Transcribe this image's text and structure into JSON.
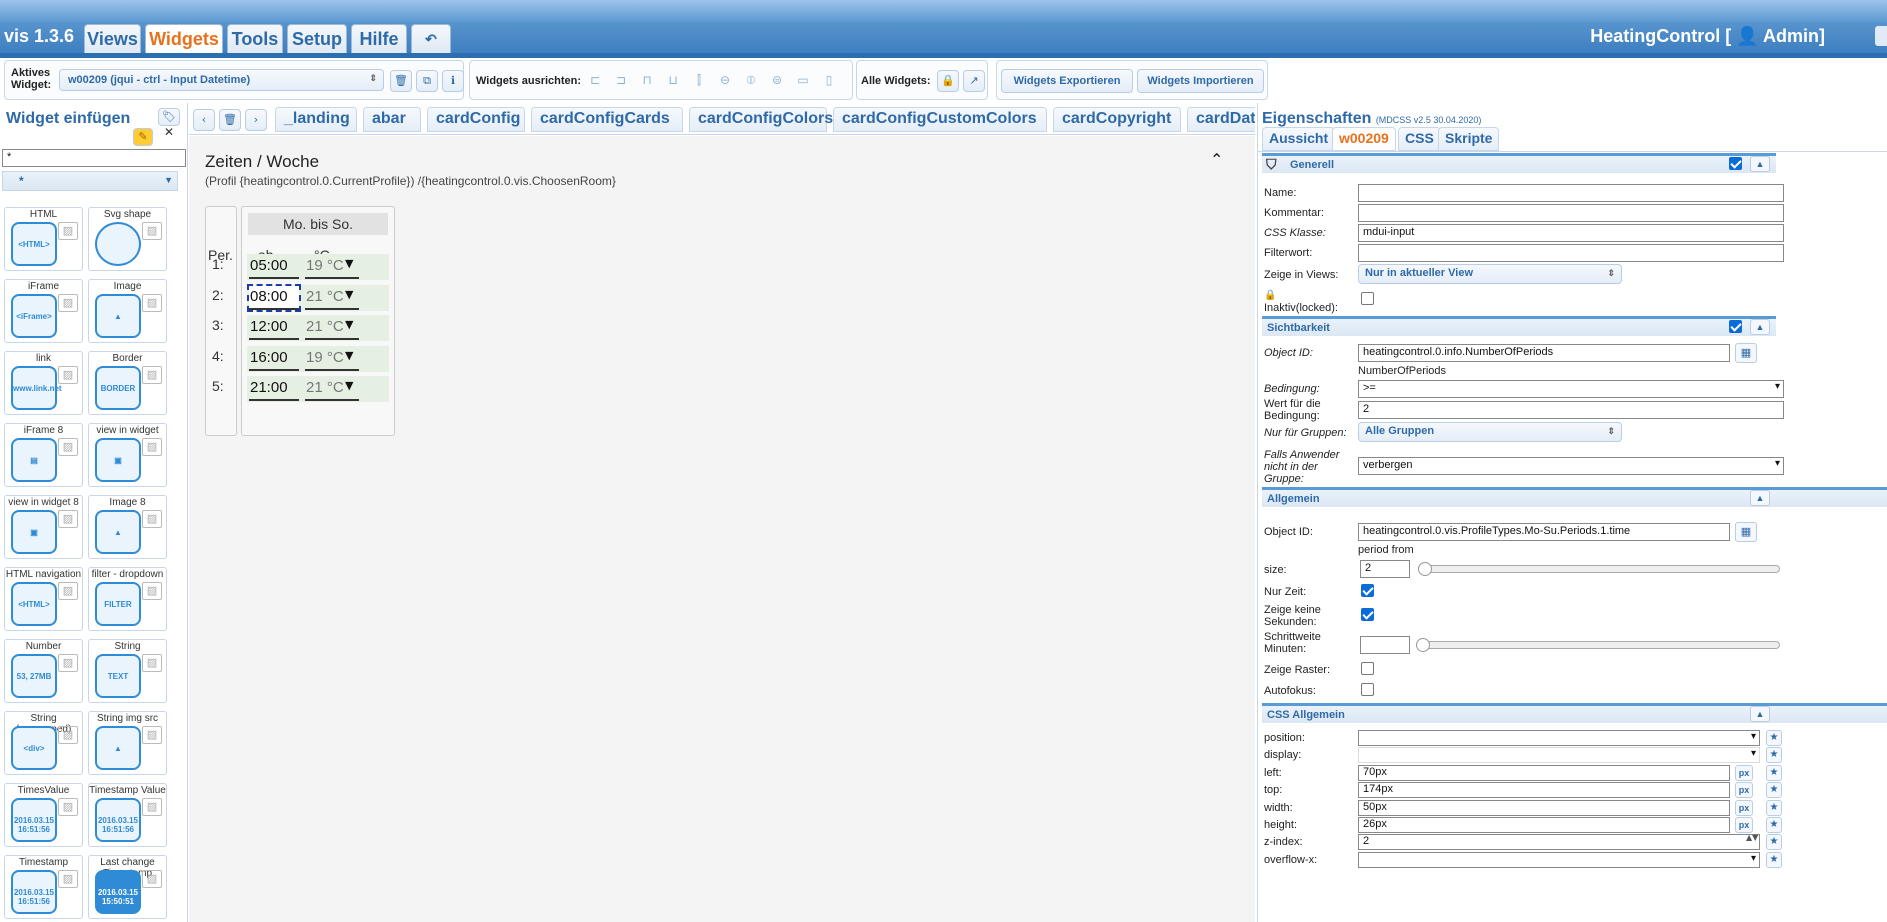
{
  "app": {
    "brand": "vis 1.3.6",
    "user": "HeatingControl [ 👤 Admin]"
  },
  "menu": {
    "views": "Views",
    "widgets": "Widgets",
    "tools": "Tools",
    "setup": "Setup",
    "hilfe": "Hilfe",
    "undo_icon": "↶"
  },
  "toolbar": {
    "active_widget_label": "Aktives Widget:",
    "active_widget_value": "w00209 (jqui - ctrl - Input Datetime)",
    "align_label": "Widgets ausrichten:",
    "all_label": "Alle Widgets:",
    "export": "Widgets Exportieren",
    "import": "Widgets Importieren"
  },
  "left_panel": {
    "title": "Widget einfügen",
    "filter_value": "*",
    "category_value": "*",
    "widgets": [
      {
        "name": "HTML",
        "icon": "<HTML>"
      },
      {
        "name": "Svg shape",
        "icon": ""
      },
      {
        "name": "iFrame",
        "icon": "<iFrame>"
      },
      {
        "name": "Image",
        "icon": "▲"
      },
      {
        "name": "link",
        "icon": "www.link.net"
      },
      {
        "name": "Border",
        "icon": "BORDER"
      },
      {
        "name": "iFrame 8",
        "icon": "▤"
      },
      {
        "name": "view in widget",
        "icon": "▣"
      },
      {
        "name": "view in widget 8",
        "icon": "▣"
      },
      {
        "name": "Image 8",
        "icon": "▲"
      },
      {
        "name": "HTML navigation",
        "icon": "<HTML>"
      },
      {
        "name": "filter - dropdown",
        "icon": "FILTER"
      },
      {
        "name": "Number",
        "icon": "53, 27MB"
      },
      {
        "name": "String",
        "icon": "TEXT"
      },
      {
        "name": "String (unescaped)",
        "icon": "<div>"
      },
      {
        "name": "String img src",
        "icon": "▲"
      },
      {
        "name": "TimesValue",
        "icon": "2016.03.15 16:51:56"
      },
      {
        "name": "Timestamp Value",
        "icon": "2016.03.15 16:51:56"
      },
      {
        "name": "Timestamp",
        "icon": "2016.03.15 16:51:56"
      },
      {
        "name": "Last change Timestamp",
        "icon": "2016.03.15 15:50:51"
      }
    ]
  },
  "view_tabs": [
    "_landing",
    "abar",
    "cardConfig",
    "cardConfigCards",
    "cardConfigColors",
    "cardConfigCustomColors",
    "cardCopyright",
    "cardDateAnd"
  ],
  "canvas": {
    "title": "Zeiten / Woche",
    "subtitle": "(Profil {heatingcontrol.0.CurrentProfile}) /{heatingcontrol.0.vis.ChoosenRoom}",
    "per_label": "Per.",
    "day_header": "Mo. bis So.",
    "col_ab": "ab",
    "col_temp": "°C",
    "rows": [
      {
        "nr": "1:",
        "time": "05:00",
        "temp": "19 °C"
      },
      {
        "nr": "2:",
        "time": "08:00",
        "temp": "21 °C"
      },
      {
        "nr": "3:",
        "time": "12:00",
        "temp": "21 °C"
      },
      {
        "nr": "4:",
        "time": "16:00",
        "temp": "19 °C"
      },
      {
        "nr": "5:",
        "time": "21:00",
        "temp": "21 °C"
      }
    ]
  },
  "right_panel": {
    "title": "Eigenschaften",
    "title_small": "(MDCSS v2.5 30.04.2020)",
    "tabs": [
      "Aussicht",
      "w00209",
      "CSS",
      "Skripte"
    ],
    "generell": {
      "header": "Generell",
      "name_label": "Name:",
      "name_value": "",
      "kommentar_label": "Kommentar:",
      "kommentar_value": "",
      "css_klasse_label": "CSS Klasse:",
      "css_klasse_value": "mdui-input",
      "filterwort_label": "Filterwort:",
      "filterwort_value": "",
      "zeige_label": "Zeige in Views:",
      "zeige_value": "Nur in aktueller View",
      "inaktiv_label": "Inaktiv(locked):"
    },
    "sichtbarkeit": {
      "header": "Sichtbarkeit",
      "oid_label": "Object ID:",
      "oid_value": "heatingcontrol.0.info.NumberOfPeriods",
      "oid_hint": "NumberOfPeriods",
      "bedingung_label": "Bedingung:",
      "bedingung_value": ">=",
      "wert_label": "Wert für die Bedingung:",
      "wert_value": "2",
      "gruppen_label": "Nur für Gruppen:",
      "gruppen_value": "Alle Gruppen",
      "falls_label": "Falls Anwender nicht in der Gruppe:",
      "falls_value": "verbergen"
    },
    "allgemein": {
      "header": "Allgemein",
      "oid_label": "Object ID:",
      "oid_value": "heatingcontrol.0.vis.ProfileTypes.Mo-Su.Periods.1.time",
      "oid_hint": "period from",
      "size_label": "size:",
      "size_value": "2",
      "nurzeit_label": "Nur Zeit:",
      "sekunden_label": "Zeige keine Sekunden:",
      "schritt_label": "Schrittweite Minuten:",
      "schritt_value": "",
      "raster_label": "Zeige Raster:",
      "autofokus_label": "Autofokus:"
    },
    "css_allgemein": {
      "header": "CSS Allgemein",
      "rows": [
        {
          "label": "position:",
          "value": "",
          "type": "select"
        },
        {
          "label": "display:",
          "value": "",
          "type": "select"
        },
        {
          "label": "left:",
          "value": "70px",
          "type": "px"
        },
        {
          "label": "top:",
          "value": "174px",
          "type": "px"
        },
        {
          "label": "width:",
          "value": "50px",
          "type": "px"
        },
        {
          "label": "height:",
          "value": "26px",
          "type": "px"
        },
        {
          "label": "z-index:",
          "value": "2",
          "type": "number"
        },
        {
          "label": "overflow-x:",
          "value": "",
          "type": "select"
        }
      ]
    }
  },
  "colors": {
    "accent": "#e8721c",
    "brand": "#2f6aa8",
    "canvas_row": "#e6f0e2"
  }
}
